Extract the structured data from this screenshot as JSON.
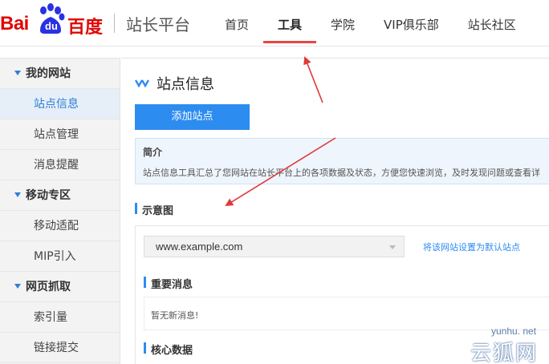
{
  "header": {
    "logo": {
      "bai": "Bai",
      "du": "du",
      "cn": "百度"
    },
    "platform_title": "站长平台",
    "nav": [
      {
        "label": "首页",
        "active": false
      },
      {
        "label": "工具",
        "active": true
      },
      {
        "label": "学院",
        "active": false
      },
      {
        "label": "VIP俱乐部",
        "active": false
      },
      {
        "label": "站长社区",
        "active": false
      }
    ]
  },
  "sidebar": {
    "groups": [
      {
        "label": "我的网站",
        "items": [
          "站点信息",
          "站点管理",
          "消息提醒"
        ]
      },
      {
        "label": "移动专区",
        "items": [
          "移动适配",
          "MIP引入"
        ]
      },
      {
        "label": "网页抓取",
        "items": [
          "索引量",
          "链接提交"
        ]
      }
    ],
    "active_item": "站点信息"
  },
  "main": {
    "page_title": "站点信息",
    "add_button": "添加站点",
    "intro": {
      "title": "简介",
      "text": "站点信息工具汇总了您网站在站长平台上的各项数据及状态，方便您快速浏览，及时发现问题或查看详"
    },
    "diagram_heading": "示意图",
    "site_select_value": "www.example.com",
    "set_default_link": "将该网站设置为默认站点",
    "important_heading": "重要消息",
    "no_message": "暂无新消息!",
    "core_heading": "核心数据"
  },
  "watermark": {
    "url": "yunhu. net",
    "cn": "云狐网"
  },
  "colors": {
    "brand_red": "#e10602",
    "accent_blue": "#2d8cf0",
    "nav_underline": "#e84545",
    "arrow": "#e0393b"
  }
}
